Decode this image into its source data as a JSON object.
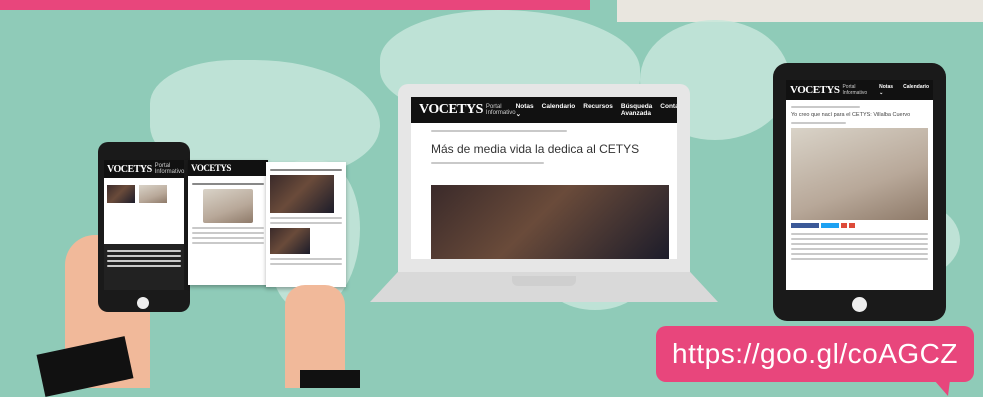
{
  "brand": {
    "logo": "VOCETYS",
    "subtitle": "Portal Informativo"
  },
  "laptop": {
    "nav": [
      "Notas ⌄",
      "Calendario",
      "Recursos",
      "Búsqueda Avanzada",
      "Contacto"
    ],
    "article_title": "Más de media vida la dedica al CETYS"
  },
  "tablet": {
    "nav": [
      "Notas ⌄",
      "Calendario"
    ],
    "article_title": "Yo creo que nací para el CETYS: Villalba Cuervo"
  },
  "url": "https://goo.gl/coAGCZ",
  "colors": {
    "background": "#8fcbb8",
    "accent_pink": "#e8467c",
    "header_black": "#111111"
  }
}
